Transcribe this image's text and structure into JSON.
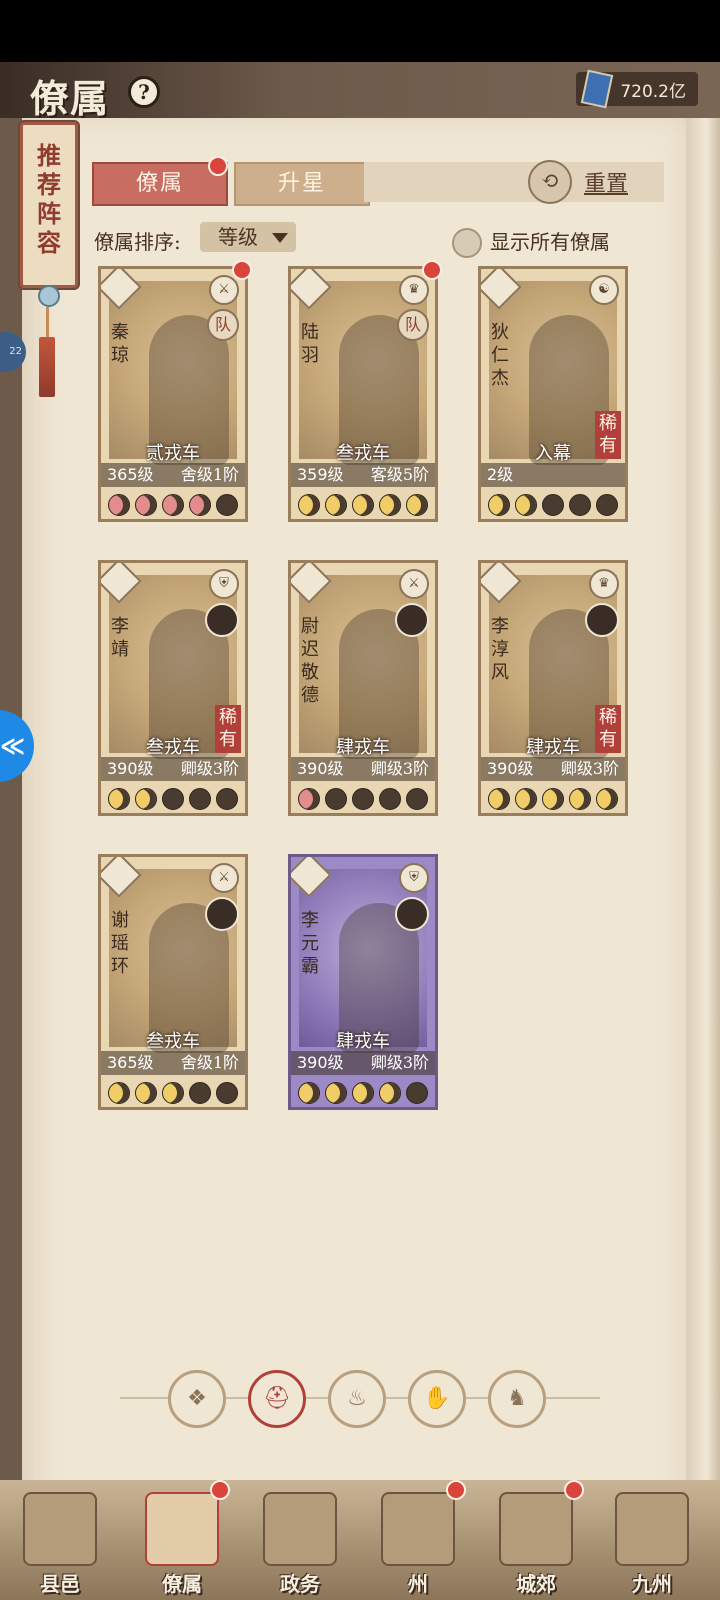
{
  "header": {
    "title": "僚属",
    "help_icon": "question-icon",
    "currency_icon": "book-icon",
    "currency": "720.2亿"
  },
  "banner": {
    "text": "推荐阵容"
  },
  "side_stub": "22",
  "tabs": [
    {
      "label": "僚属",
      "active": true,
      "badge": true
    },
    {
      "label": "升星",
      "active": false,
      "badge": false
    }
  ],
  "reset": {
    "label": "重置",
    "icon": "reset-icon"
  },
  "sort": {
    "label": "僚属排序:",
    "value": "等级"
  },
  "show_all": {
    "label": "显示所有僚属",
    "checked": false
  },
  "cards": [
    {
      "name": "秦琼",
      "rank": "贰戎车",
      "level": "365级",
      "grade": "舍级1阶",
      "role": "队",
      "class_icon": "sword-icon",
      "badge": true,
      "rare": "",
      "moons": [
        "pink",
        "pink",
        "pink",
        "pink",
        "off"
      ],
      "theme": "gold"
    },
    {
      "name": "陆羽",
      "rank": "叁戎车",
      "level": "359级",
      "grade": "客级5阶",
      "role": "队",
      "class_icon": "crown-icon",
      "badge": true,
      "rare": "",
      "moons": [
        "on",
        "on",
        "on",
        "on",
        "on"
      ],
      "theme": "gold"
    },
    {
      "name": "狄仁杰",
      "rank": "入幕",
      "level": "2级",
      "grade": "",
      "role": "",
      "class_icon": "taiji-icon",
      "badge": false,
      "rare": "稀有",
      "moons": [
        "on",
        "on",
        "off",
        "off",
        "off"
      ],
      "theme": "gold"
    },
    {
      "name": "李靖",
      "rank": "叁戎车",
      "level": "390级",
      "grade": "卿级3阶",
      "role": "",
      "class_icon": "shield-icon",
      "badge": false,
      "rare": "稀有",
      "moons": [
        "on",
        "on",
        "off",
        "off",
        "off"
      ],
      "theme": "gold"
    },
    {
      "name": "尉迟敬德",
      "rank": "肆戎车",
      "level": "390级",
      "grade": "卿级3阶",
      "role": "",
      "class_icon": "sword-icon",
      "badge": false,
      "rare": "",
      "moons": [
        "pink",
        "off",
        "off",
        "off",
        "off"
      ],
      "theme": "gold"
    },
    {
      "name": "李淳风",
      "rank": "肆戎车",
      "level": "390级",
      "grade": "卿级3阶",
      "role": "",
      "class_icon": "crown-icon",
      "badge": false,
      "rare": "稀有",
      "moons": [
        "on",
        "on",
        "on",
        "on",
        "on"
      ],
      "theme": "gold"
    },
    {
      "name": "谢瑶环",
      "rank": "叁戎车",
      "level": "365级",
      "grade": "舍级1阶",
      "role": "",
      "class_icon": "sword-icon",
      "badge": false,
      "rare": "",
      "moons": [
        "on",
        "on",
        "on",
        "off",
        "off"
      ],
      "theme": "gold"
    },
    {
      "name": "李元霸",
      "rank": "肆戎车",
      "level": "390级",
      "grade": "卿级3阶",
      "role": "",
      "class_icon": "shield-icon",
      "badge": false,
      "rare": "",
      "moons": [
        "on",
        "on",
        "on",
        "on",
        "off"
      ],
      "theme": "purple"
    }
  ],
  "filters": [
    {
      "icon": "diamond-icon",
      "glyph": "❖",
      "active": false
    },
    {
      "icon": "helmet-icon",
      "glyph": "⛑",
      "active": true
    },
    {
      "icon": "gourd-icon",
      "glyph": "♨",
      "active": false
    },
    {
      "icon": "fan-icon",
      "glyph": "✋",
      "active": false
    },
    {
      "icon": "lion-icon",
      "glyph": "♞",
      "active": false
    }
  ],
  "nav": [
    {
      "label": "县邑",
      "badge": false,
      "active": false
    },
    {
      "label": "僚属",
      "badge": true,
      "active": true
    },
    {
      "label": "政务",
      "badge": false,
      "active": false
    },
    {
      "label": "州",
      "badge": true,
      "active": false
    },
    {
      "label": "城郊",
      "badge": true,
      "active": false
    },
    {
      "label": "九州",
      "badge": false,
      "active": false
    }
  ]
}
